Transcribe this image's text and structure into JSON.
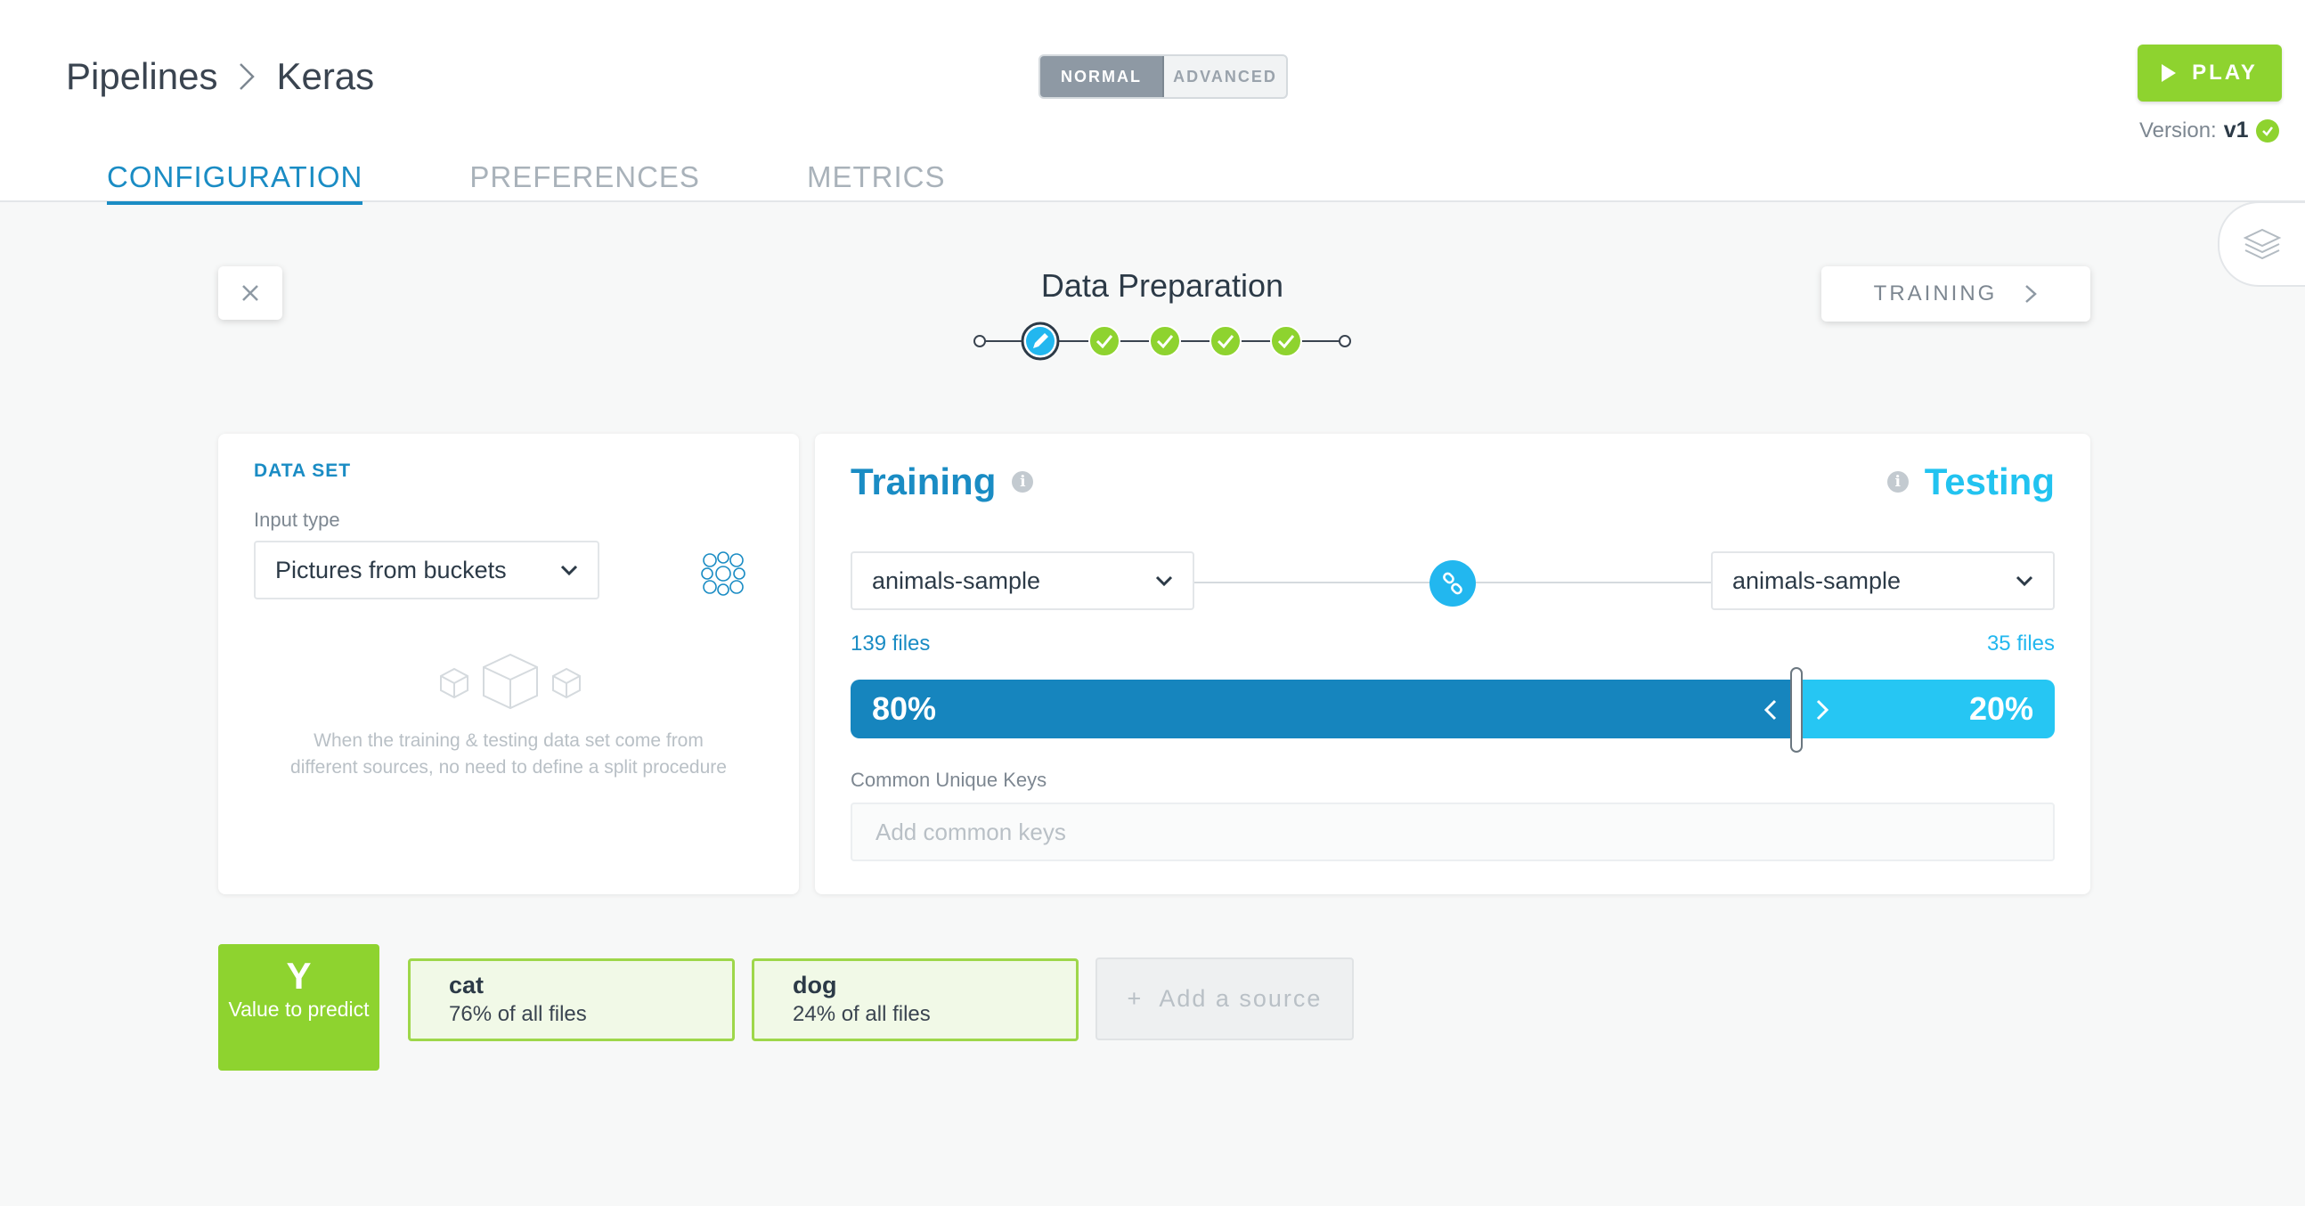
{
  "breadcrumb": {
    "root": "Pipelines",
    "current": "Keras"
  },
  "mode_toggle": {
    "normal": "NORMAL",
    "advanced": "ADVANCED",
    "selected": "NORMAL"
  },
  "play_button": {
    "label": "PLAY"
  },
  "version": {
    "label": "Version:",
    "value": "v1"
  },
  "tabs": [
    {
      "label": "CONFIGURATION",
      "active": true
    },
    {
      "label": "PREFERENCES",
      "active": false
    },
    {
      "label": "METRICS",
      "active": false
    }
  ],
  "step": {
    "title": "Data Preparation",
    "next_label": "TRAINING",
    "total_steps": 5,
    "current_step": 1,
    "completed_steps": 4
  },
  "dataset_panel": {
    "section_label": "DATA SET",
    "input_type_label": "Input type",
    "input_type_value": "Pictures from buckets",
    "hint": "When the training & testing data set come from different sources, no need to define a split procedure"
  },
  "split_panel": {
    "training_title": "Training",
    "testing_title": "Testing",
    "training_source": "animals-sample",
    "testing_source": "animals-sample",
    "training_files": "139 files",
    "testing_files": "35 files",
    "training_pct": "80%",
    "testing_pct": "20%",
    "training_fraction": 0.8,
    "common_keys_label": "Common Unique Keys",
    "common_keys_placeholder": "Add common keys"
  },
  "target": {
    "letter": "Y",
    "label": "Value to predict"
  },
  "classes": [
    {
      "name": "cat",
      "share": "76% of all files"
    },
    {
      "name": "dog",
      "share": "24% of all files"
    }
  ],
  "add_source": {
    "label": "Add a source"
  },
  "colors": {
    "primary": "#1a8cc4",
    "testing": "#22c3f0",
    "accent_green": "#8ed32f"
  }
}
